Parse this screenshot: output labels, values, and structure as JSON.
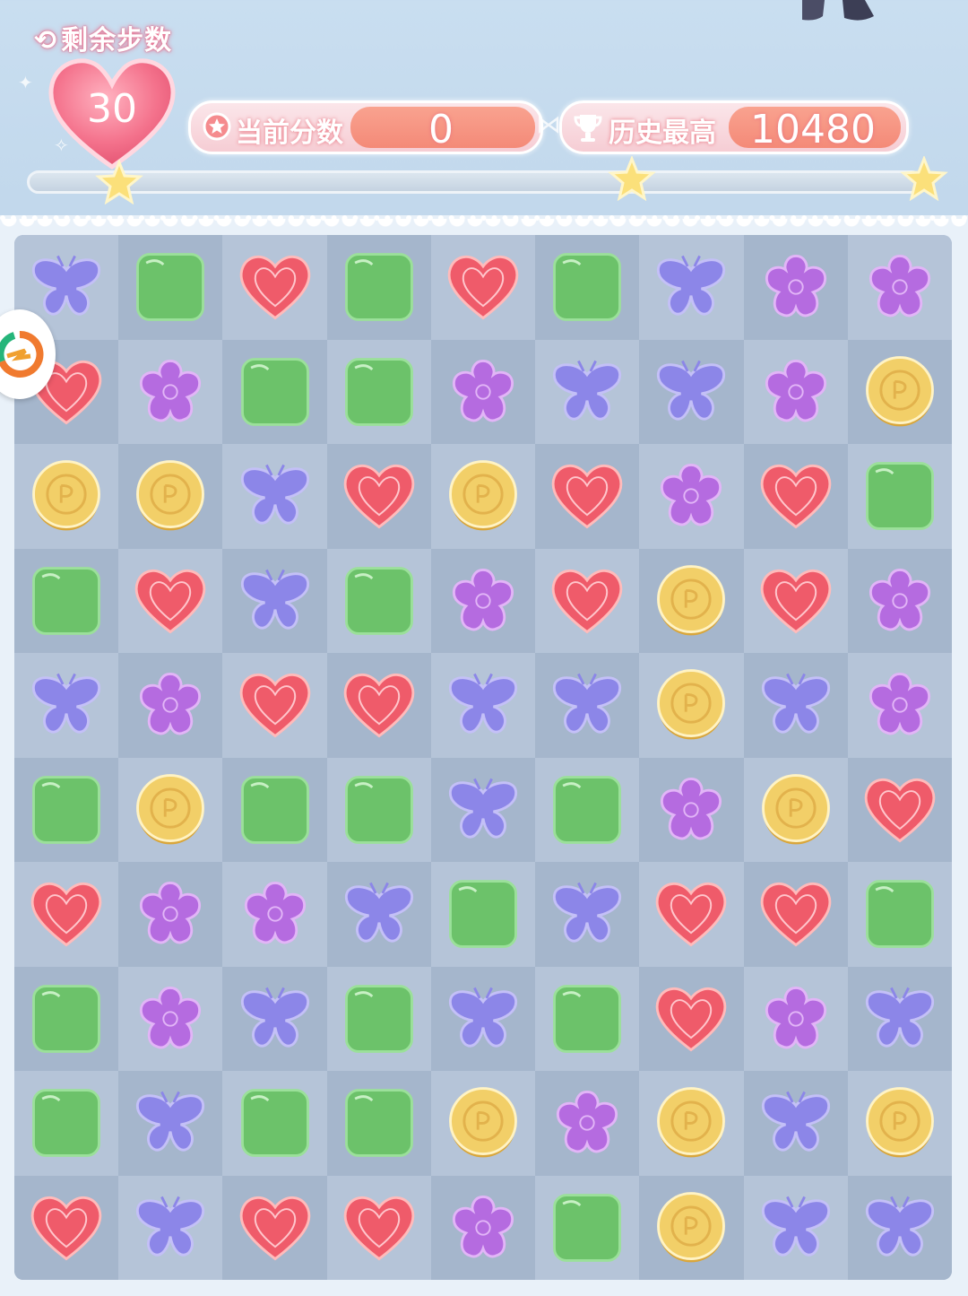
{
  "hud": {
    "moves_label": "剩余步数",
    "moves_left": "30",
    "score_label": "当前分数",
    "score_value": "0",
    "best_label": "历史最高",
    "best_value": "10480"
  },
  "progress": {
    "fraction": 0,
    "stars": 3
  },
  "icons": {
    "moves": "cycle-arrows-icon",
    "score": "star-circle-icon",
    "best": "trophy-icon",
    "side": "swirl-logo-icon"
  },
  "colors": {
    "heart": "#ef5b6a",
    "square": "#6cc26a",
    "flower": "#b56be0",
    "butterfly": "#8c86e8",
    "coin": "#f2cf68"
  },
  "board": {
    "columns": 9,
    "rows": [
      [
        "butterfly",
        "square",
        "heart",
        "square",
        "heart",
        "square",
        "butterfly",
        "flower",
        "flower"
      ],
      [
        "heart",
        "flower",
        "square",
        "square",
        "flower",
        "butterfly",
        "butterfly",
        "flower",
        "coin"
      ],
      [
        "coin",
        "coin",
        "butterfly",
        "heart",
        "coin",
        "heart",
        "flower",
        "heart",
        "square"
      ],
      [
        "square",
        "heart",
        "butterfly",
        "square",
        "flower",
        "heart",
        "coin",
        "heart",
        "flower"
      ],
      [
        "butterfly",
        "flower",
        "heart",
        "heart",
        "butterfly",
        "butterfly",
        "coin",
        "butterfly",
        "flower"
      ],
      [
        "square",
        "coin",
        "square",
        "square",
        "butterfly",
        "square",
        "flower",
        "coin",
        "heart"
      ],
      [
        "heart",
        "flower",
        "flower",
        "butterfly",
        "square",
        "butterfly",
        "heart",
        "heart",
        "square"
      ],
      [
        "square",
        "flower",
        "butterfly",
        "square",
        "butterfly",
        "square",
        "heart",
        "flower",
        "butterfly"
      ],
      [
        "square",
        "butterfly",
        "square",
        "square",
        "coin",
        "flower",
        "coin",
        "butterfly",
        "coin"
      ],
      [
        "heart",
        "butterfly",
        "heart",
        "heart",
        "flower",
        "square",
        "coin",
        "butterfly",
        "butterfly"
      ]
    ]
  }
}
